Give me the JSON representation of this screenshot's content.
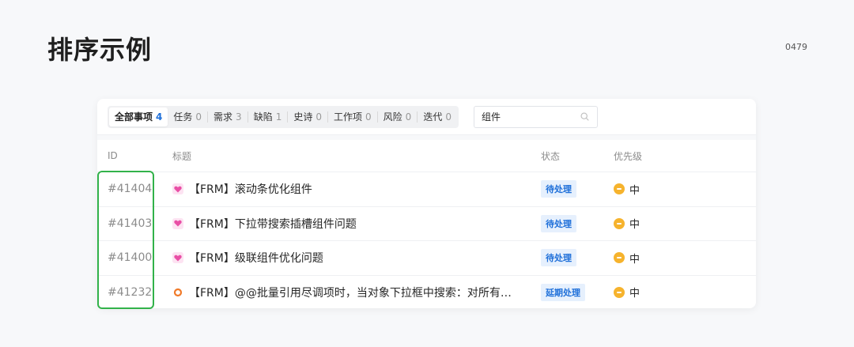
{
  "page": {
    "title": "排序示例",
    "number": "0479"
  },
  "tabs": [
    {
      "label": "全部事项",
      "count": "4",
      "active": true
    },
    {
      "label": "任务",
      "count": "0"
    },
    {
      "label": "需求",
      "count": "3"
    },
    {
      "label": "缺陷",
      "count": "1"
    },
    {
      "label": "史诗",
      "count": "0"
    },
    {
      "label": "工作项",
      "count": "0"
    },
    {
      "label": "风险",
      "count": "0"
    },
    {
      "label": "迭代",
      "count": "0"
    }
  ],
  "search": {
    "value": "组件",
    "icon": "search-icon"
  },
  "table": {
    "headers": {
      "id": "ID",
      "title": "标题",
      "status": "状态",
      "priority": "优先级"
    },
    "rows": [
      {
        "id": "#41404",
        "type": "heart-icon",
        "title": "【FRM】滚动条优化组件",
        "status": "待处理",
        "priority": "中"
      },
      {
        "id": "#41403",
        "type": "heart-icon",
        "title": "【FRM】下拉带搜索插槽组件问题",
        "status": "待处理",
        "priority": "中"
      },
      {
        "id": "#41400",
        "type": "heart-icon",
        "title": "【FRM】级联组件优化问题",
        "status": "待处理",
        "priority": "中"
      },
      {
        "id": "#41232",
        "type": "ring-icon",
        "title": "【FRM】@@批量引用尽调项时，当对象下拉框中搜索：对所有配…",
        "status": "延期处理",
        "priority": "中"
      }
    ]
  },
  "colors": {
    "accent": "#1e6fd9",
    "highlight": "#32b24a",
    "priority_medium": "#f6b32d",
    "requirement": "#e94fa6",
    "iteration": "#f07a2a"
  }
}
